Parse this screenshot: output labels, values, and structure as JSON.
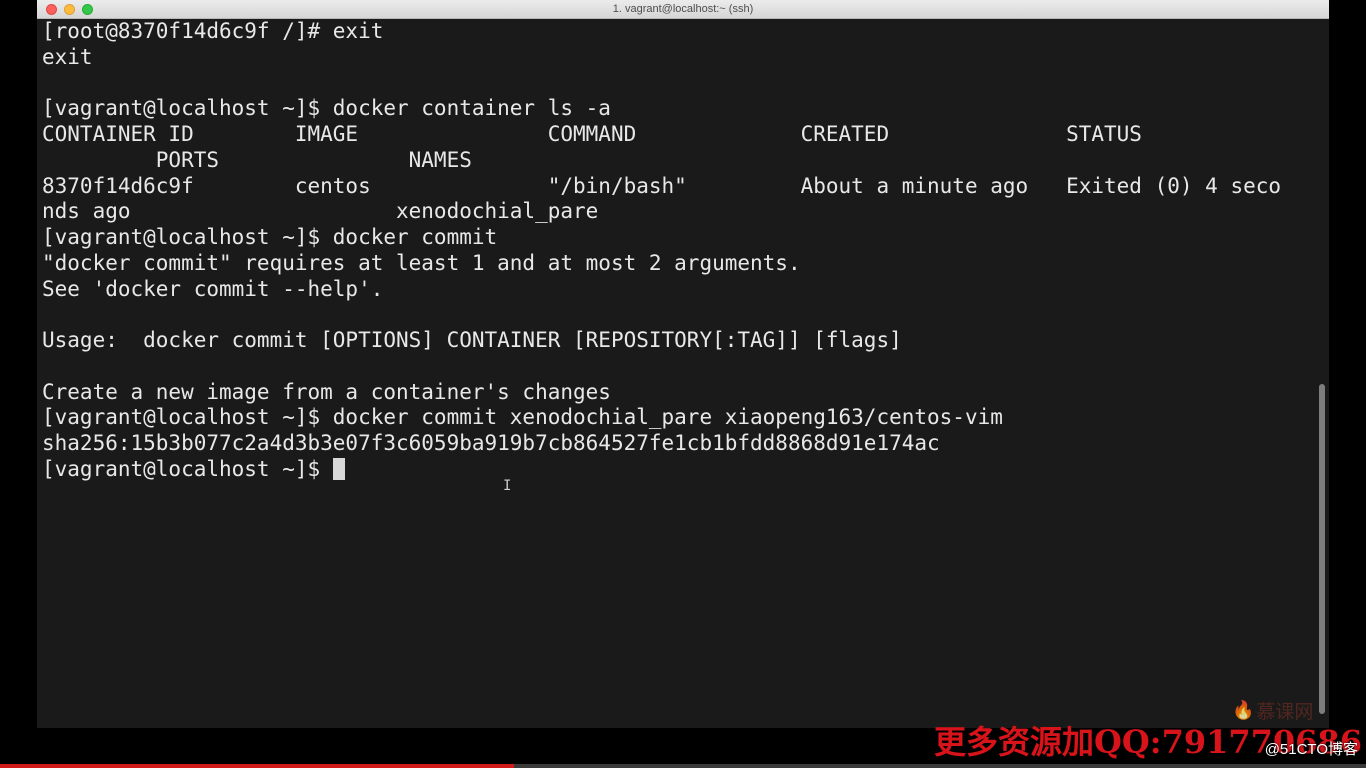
{
  "window": {
    "title": "1. vagrant@localhost:~ (ssh)"
  },
  "terminal": {
    "lines": [
      "[root@8370f14d6c9f /]# exit",
      "exit",
      "",
      "[vagrant@localhost ~]$ docker container ls -a",
      "CONTAINER ID        IMAGE               COMMAND             CREATED              STATUS",
      "         PORTS               NAMES",
      "8370f14d6c9f        centos              \"/bin/bash\"         About a minute ago   Exited (0) 4 seco",
      "nds ago                     xenodochial_pare",
      "[vagrant@localhost ~]$ docker commit",
      "\"docker commit\" requires at least 1 and at most 2 arguments.",
      "See 'docker commit --help'.",
      "",
      "Usage:  docker commit [OPTIONS] CONTAINER [REPOSITORY[:TAG]] [flags]",
      "",
      "Create a new image from a container's changes",
      "[vagrant@localhost ~]$ docker commit xenodochial_pare xiaopeng163/centos-vim",
      "sha256:15b3b077c2a4d3b3e07f3c6059ba919b7cb864527fe1cb1bfdd8868d91e174ac"
    ],
    "prompt": "[vagrant@localhost ~]$ ",
    "cursor_glyph": "█"
  },
  "overlay": {
    "brand_logo": "慕课网",
    "promo_text": "更多资源加QQ:791770686",
    "source_text": "@51CTO博客",
    "video_progress": 0.376
  },
  "colors": {
    "terminal_bg": "#1a1a1a",
    "terminal_fg": "#e8e8e8",
    "promo_red": "#d8141a",
    "progress_red": "#d11b1b"
  }
}
